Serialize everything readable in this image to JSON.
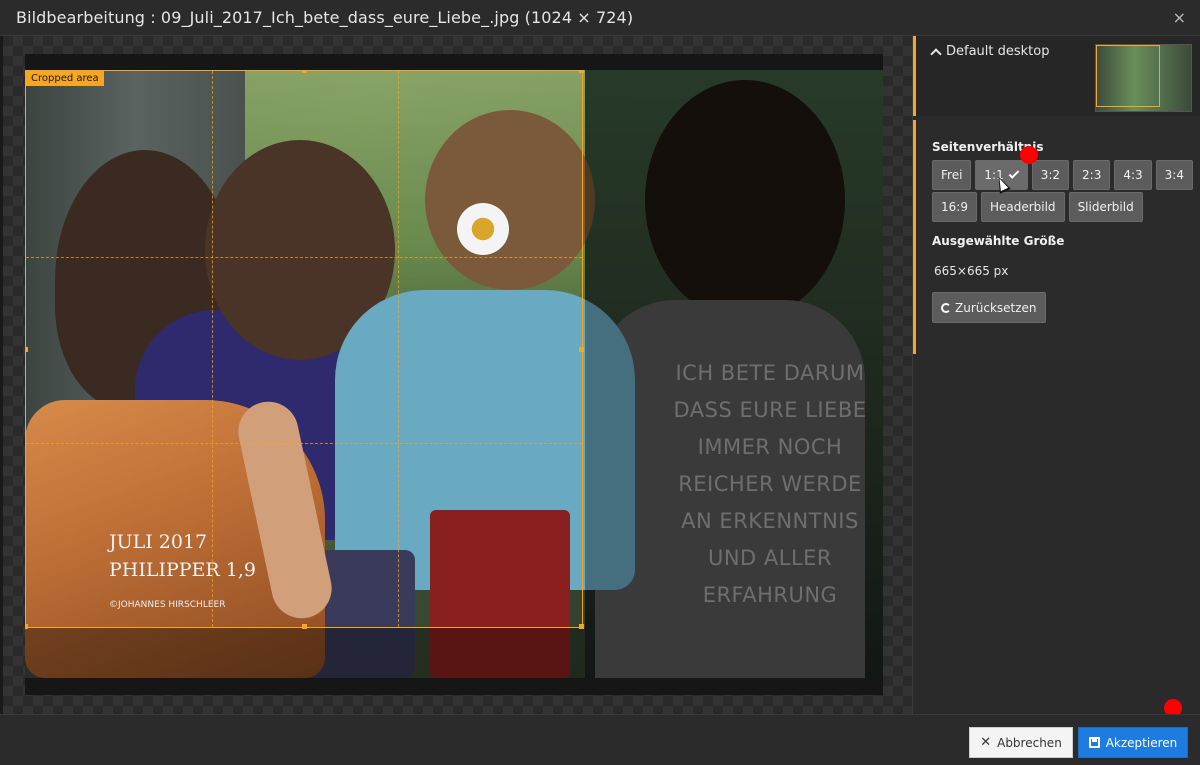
{
  "dialog": {
    "title": "Bildbearbeitung : 09_Juli_2017_Ich_bete_dass_eure_Liebe_.jpg (1024 × 724)",
    "close_glyph": "×"
  },
  "image": {
    "crop_label": "Cropped area",
    "back_text_lines": [
      "ICH BETE DARUM",
      "DASS EURE LIEBE",
      "IMMER NOCH",
      "REICHER WERDE",
      "AN ERKENNTNIS",
      "UND ALLER",
      "ERFAHRUNG"
    ],
    "card_text_lines": [
      "JULI 2017",
      "PHILIPPER 1,9"
    ],
    "copyright": "©JOHANNES HIRSCHLEER"
  },
  "sidebar": {
    "variant_name": "Default desktop",
    "aspect_label": "Seitenverhältnis",
    "ratios_row1": [
      "Frei",
      "1:1",
      "3:2",
      "2:3",
      "4:3",
      "3:4"
    ],
    "ratios_row2": [
      "16:9",
      "Headerbild",
      "Sliderbild"
    ],
    "active_ratio": "1:1",
    "size_label": "Ausgewählte Größe",
    "size_value": "665×665 px",
    "reset_label": "Zurücksetzen"
  },
  "footer": {
    "cancel_label": "Abbrechen",
    "accept_label": "Akzeptieren"
  },
  "colors": {
    "accent": "#f5a623",
    "primary_button": "#1e7be0",
    "marker": "#ff0000"
  },
  "icons": [
    "close-icon",
    "chevron-up-icon",
    "check-icon",
    "refresh-icon",
    "times-icon",
    "save-icon",
    "mouse-cursor"
  ]
}
